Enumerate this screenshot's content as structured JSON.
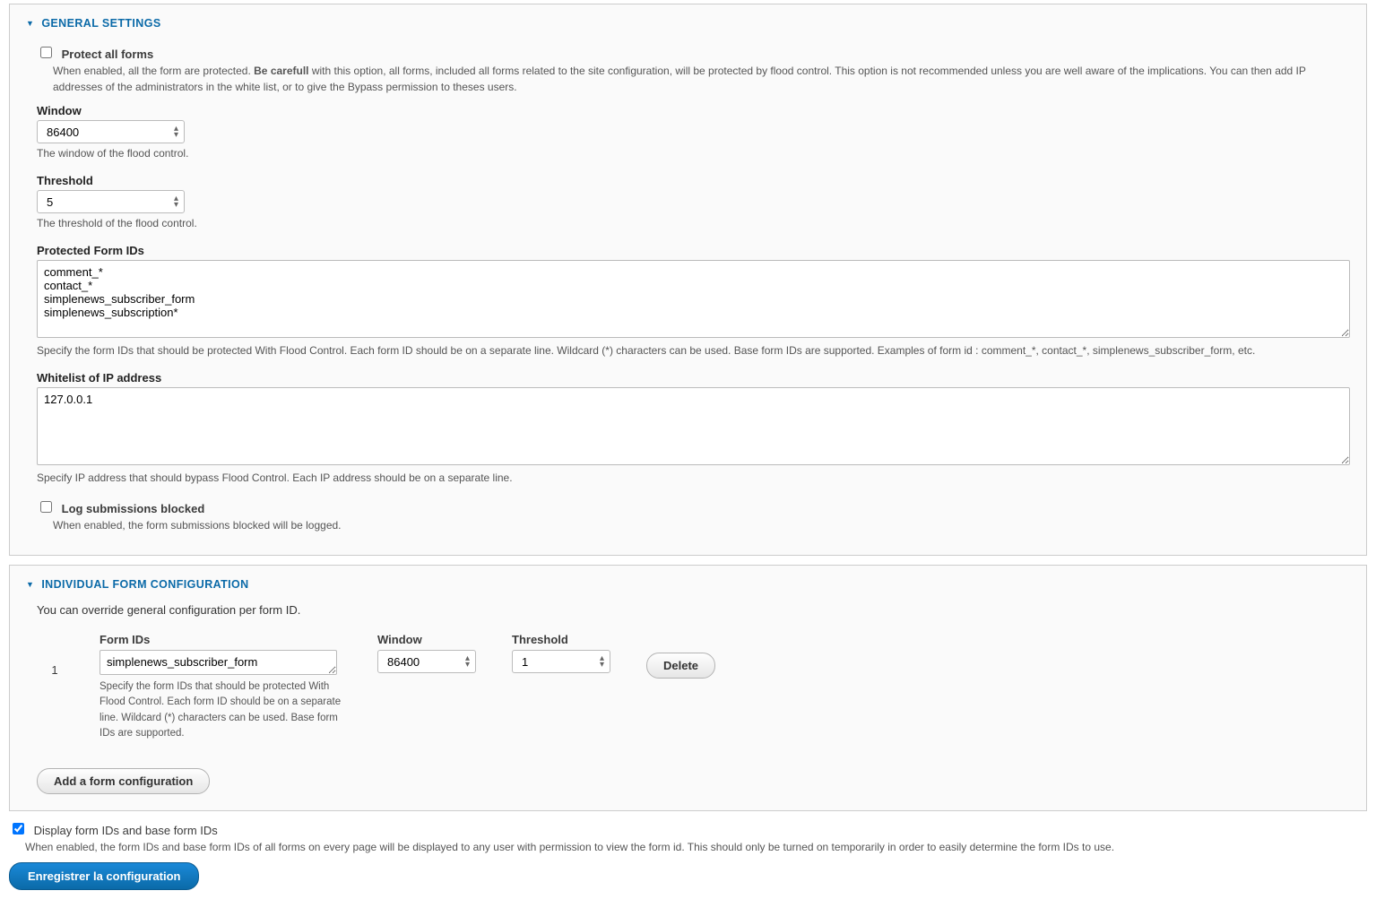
{
  "general": {
    "title": "GENERAL SETTINGS",
    "protect_all": {
      "label": "Protect all forms",
      "checked": false,
      "description_prefix": "When enabled, all the form are protected. ",
      "description_bold": "Be carefull",
      "description_suffix": " with this option, all forms, included all forms related to the site configuration, will be protected by flood control. This option is not recommended unless you are well aware of the implications. You can then add IP addresses of the administrators in the white list, or to give the Bypass permission to theses users."
    },
    "window": {
      "label": "Window",
      "value": "86400",
      "description": "The window of the flood control."
    },
    "threshold": {
      "label": "Threshold",
      "value": "5",
      "description": "The threshold of the flood control."
    },
    "protected_ids": {
      "label": "Protected Form IDs",
      "value": "comment_*\ncontact_*\nsimplenews_subscriber_form\nsimplenews_subscription*",
      "description": "Specify the form IDs that should be protected With Flood Control. Each form ID should be on a separate line. Wildcard (*) characters can be used. Base form IDs are supported. Examples of form id : comment_*, contact_*, simplenews_subscriber_form, etc."
    },
    "whitelist": {
      "label": "Whitelist of IP address",
      "value": "127.0.0.1",
      "description": "Specify IP address that should bypass Flood Control. Each IP address should be on a separate line."
    },
    "log": {
      "label": "Log submissions blocked",
      "checked": false,
      "description": "When enabled, the form submissions blocked will be logged."
    }
  },
  "individual": {
    "title": "INDIVIDUAL FORM CONFIGURATION",
    "intro": "You can override general configuration per form ID.",
    "headers": {
      "form_ids": "Form IDs",
      "window": "Window",
      "threshold": "Threshold"
    },
    "rows": [
      {
        "index": "1",
        "form_ids": "simplenews_subscriber_form",
        "form_ids_desc": "Specify the form IDs that should be protected With Flood Control. Each form ID should be on a separate line. Wildcard (*) characters can be used. Base form IDs are supported.",
        "window": "86400",
        "threshold": "1",
        "delete_label": "Delete"
      }
    ],
    "add_button": "Add a form configuration"
  },
  "display_ids": {
    "label": "Display form IDs and base form IDs",
    "checked": true,
    "description": "When enabled, the form IDs and base form IDs of all forms on every page will be displayed to any user with permission to view the form id. This should only be turned on temporarily in order to easily determine the form IDs to use."
  },
  "submit_label": "Enregistrer la configuration"
}
